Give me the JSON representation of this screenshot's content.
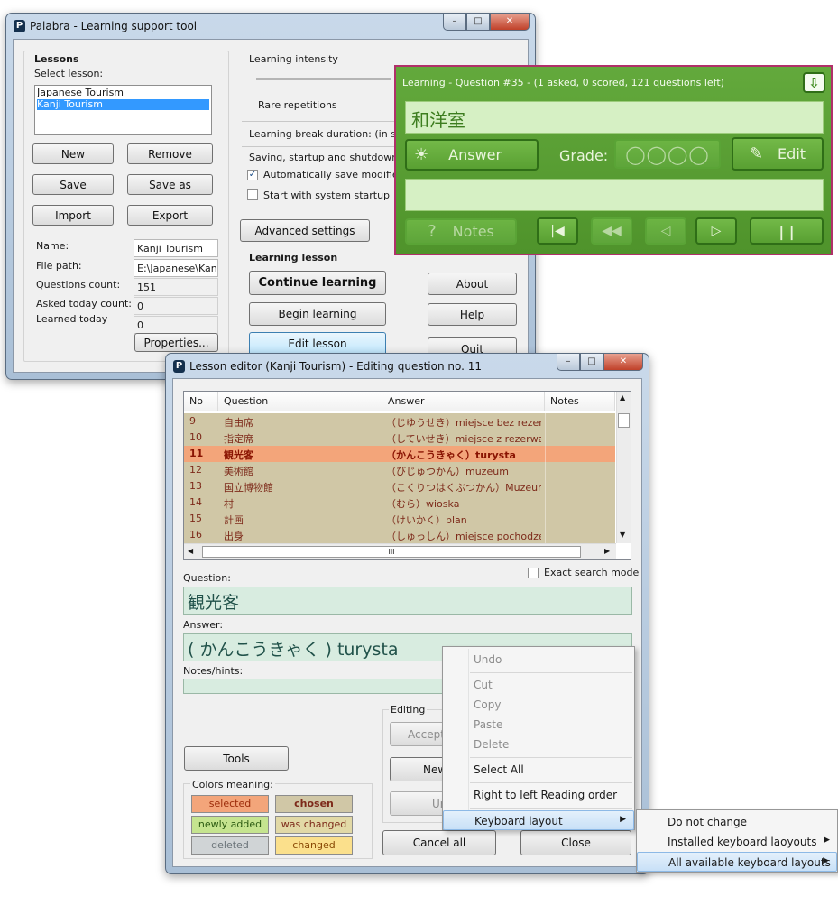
{
  "main_window": {
    "title": "Palabra - Learning support tool",
    "lessons_heading": "Lessons",
    "select_lesson_label": "Select lesson:",
    "lessons": [
      "Japanese Tourism",
      "Kanji Tourism"
    ],
    "buttons": {
      "new": "New",
      "remove": "Remove",
      "save": "Save",
      "save_as": "Save as",
      "import": "Import",
      "export": "Export",
      "properties": "Properties..."
    },
    "info": {
      "name_label": "Name:",
      "name_value": "Kanji Tourism",
      "file_path_label": "File path:",
      "file_path_value": "E:\\Japanese\\Kanji",
      "questions_count_label": "Questions count:",
      "questions_count_value": "151",
      "asked_today_label": "Asked today count:",
      "asked_today_value": "0",
      "learned_today_label": "Learned today",
      "learned_today_value": "0"
    },
    "intensity_label": "Learning intensity",
    "intensity_caption": "Rare repetitions",
    "break_label": "Learning break duration: (in secon",
    "saving_label": "Saving, startup and shutdown optio",
    "auto_save_label": "Automatically save modified les",
    "start_with_system_label": "Start with system startup",
    "advanced_settings": "Advanced settings",
    "learning_lesson_heading": "Learning lesson",
    "continue_learning": "Continue learning",
    "begin_learning": "Begin learning",
    "edit_lesson": "Edit lesson",
    "about": "About",
    "help": "Help",
    "quit": "Quit"
  },
  "learning_window": {
    "title": "Learning - Question #35 - (1 asked, 0 scored, 121 questions left)",
    "question": "和洋室",
    "answer_button": "Answer",
    "grade_label": "Grade:",
    "edit_button": "Edit",
    "notes_button": "Notes"
  },
  "editor_window": {
    "title": "Lesson editor (Kanji Tourism) -  Editing question no. 11",
    "columns": [
      "No",
      "Question",
      "Answer",
      "Notes"
    ],
    "rows": [
      {
        "no": "9",
        "question": "自由席",
        "answer": "（じゆうせき）miejsce bez rezerwa..."
      },
      {
        "no": "10",
        "question": "指定席",
        "answer": "（していせき）miejsce z rezerwacją"
      },
      {
        "no": "11",
        "question": "観光客",
        "answer": "（かんこうきゃく）turysta"
      },
      {
        "no": "12",
        "question": "美術館",
        "answer": "（びじゅつかん）muzeum"
      },
      {
        "no": "13",
        "question": "国立博物館",
        "answer": "（こくりつはくぶつかん）Muzeum Na..."
      },
      {
        "no": "14",
        "question": "村",
        "answer": "（むら）wioska"
      },
      {
        "no": "15",
        "question": "計画",
        "answer": "（けいかく）plan"
      },
      {
        "no": "16",
        "question": "出身",
        "answer": "（しゅっしん）miejsce pochodzenia"
      }
    ],
    "selected_row_no": "11",
    "scroll_label": "III",
    "exact_search_label": "Exact search mode",
    "question_label": "Question:",
    "question_value": "観光客",
    "answer_label": "Answer:",
    "answer_value": "( かんこうきゃく ) turysta",
    "notes_label": "Notes/hints:",
    "editing_label": "Editing",
    "accept_button": "Accept c",
    "new_button": "New",
    "undo_button": "Un",
    "tools_button": "Tools",
    "colors_label": "Colors meaning:",
    "colors": {
      "selected": "selected",
      "chosen": "chosen",
      "newly_added": "newly added",
      "was_changed": "was changed",
      "deleted": "deleted",
      "changed": "changed"
    },
    "cancel_all": "Cancel all",
    "close": "Close"
  },
  "context_menu": {
    "items": [
      "Undo",
      "Cut",
      "Copy",
      "Paste",
      "Delete",
      "Select All",
      "Right to left Reading order",
      "Keyboard layout"
    ],
    "submenu": [
      "Do not change",
      "Installed keyboard laoyouts",
      "All available keyboard layouts"
    ]
  },
  "colors": {
    "learning_green": "#5aa034",
    "learning_border": "#b0306a",
    "row_bg": "#d0c7a6",
    "row_selected": "#f3a57a",
    "field_bg": "#d8ece0"
  }
}
